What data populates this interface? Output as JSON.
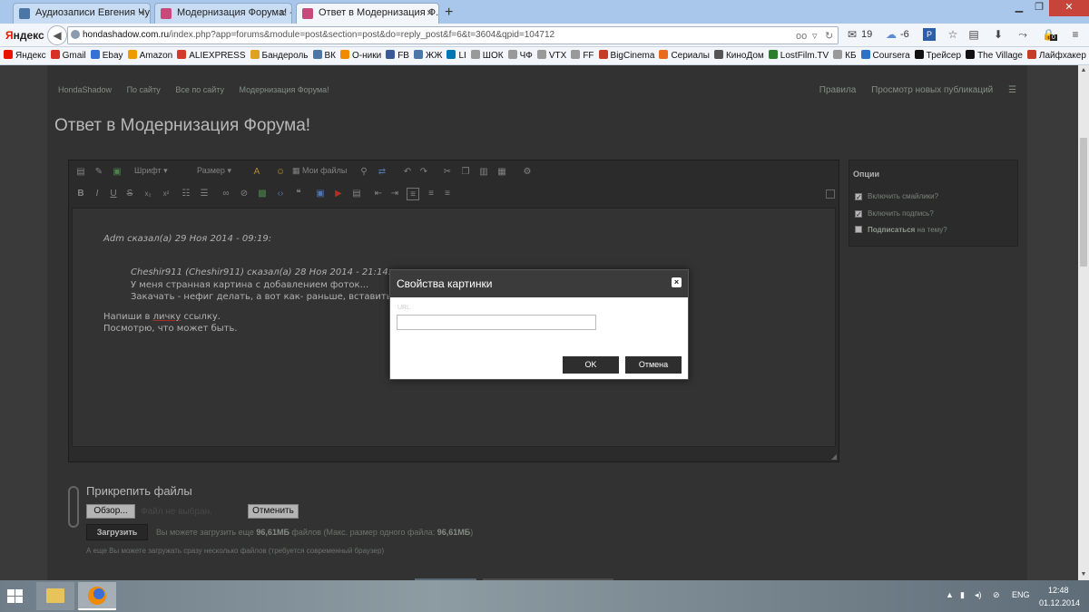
{
  "browser": {
    "tabs": [
      {
        "title": "Аудиозаписи Евгения Чур..."
      },
      {
        "title": "Модернизация Форума! - ..."
      },
      {
        "title": "Ответ в Модернизация Ф..."
      }
    ],
    "new_tab": "+",
    "close_tab": "×",
    "yandex_logo": {
      "y": "Я",
      "rest": "ндекс"
    },
    "url": {
      "host": "hondashadow.com.ru",
      "path": "/index.php?app=forums&module=post&section=post&do=reply_post&f=6&t=3604&qpid=104712"
    },
    "widgets": {
      "mail_count": "19",
      "weather_temp": "-6",
      "badge": "0"
    },
    "bookmarks": [
      {
        "label": "Яндекс",
        "color": "#e61400"
      },
      {
        "label": "Gmail",
        "color": "#d93025"
      },
      {
        "label": "Ebay",
        "color": "#3a6fd8"
      },
      {
        "label": "Amazon",
        "color": "#f09a00"
      },
      {
        "label": "ALIEXPRESS",
        "color": "#d33a2c"
      },
      {
        "label": "Бандероль",
        "color": "#e0a020"
      },
      {
        "label": "ВК",
        "color": "#4a76a8"
      },
      {
        "label": "О-ники",
        "color": "#f08a00"
      },
      {
        "label": "FB",
        "color": "#3b5998"
      },
      {
        "label": "ЖЖ",
        "color": "#4a76a8"
      },
      {
        "label": "LI",
        "color": "#0077b5"
      },
      {
        "label": "ШОК",
        "color": "#999999"
      },
      {
        "label": "ЧФ",
        "color": "#999999"
      },
      {
        "label": "VTX",
        "color": "#999999"
      },
      {
        "label": "FF",
        "color": "#999999"
      },
      {
        "label": "BigCinema",
        "color": "#c83a2a"
      },
      {
        "label": "Сериалы",
        "color": "#e86a1a"
      },
      {
        "label": "КиноДом",
        "color": "#555555"
      },
      {
        "label": "LostFilm.TV",
        "color": "#2a7f2a"
      },
      {
        "label": "КБ",
        "color": "#999999"
      },
      {
        "label": "Coursera",
        "color": "#2a73cc"
      },
      {
        "label": "Трейсер",
        "color": "#111111"
      },
      {
        "label": "The Village",
        "color": "#111111"
      },
      {
        "label": "Лайфхакер",
        "color": "#c83a2a"
      }
    ]
  },
  "forum": {
    "nav_left": [
      "HondaShadow",
      "По сайту",
      "Все по сайту",
      "Модернизация Форума!"
    ],
    "nav_right": [
      "Правила",
      "Просмотр новых публикаций"
    ],
    "page_title": "Ответ в Модернизация Форума!"
  },
  "editor": {
    "font_label": "Шрифт",
    "size_label": "Размер",
    "my_files_label": "Мои файлы",
    "quote1_header": "Adm сказал(а) 29 Ноя 2014 - 09:19:",
    "quote2_header": "Cheshir911 (Cheshir911) сказал(а) 28 Ноя 2014 - 21:14:",
    "quote2_line1": "У меня странная картина с добавлением фоток...",
    "quote2_line2": "Закачать - нефиг делать, а вот как- раньше, вставить сс",
    "reply_line1_pre": "Напиши в ",
    "reply_line1_ul": "личку",
    "reply_line1_post": " ссылку.",
    "reply_line2": "Посмотрю, что может быть."
  },
  "options": {
    "title": "Опции",
    "items": [
      {
        "label": "Включить смайлики?",
        "checked": "✓"
      },
      {
        "label": "Включить подпись?",
        "checked": "✓"
      }
    ],
    "subscribe_bold": "Подписаться",
    "subscribe_rest": " на тему?"
  },
  "attach": {
    "title": "Прикрепить файлы",
    "browse_label": "Обзор...",
    "no_file": "Файл не выбран.",
    "cancel_label": "Отменить",
    "upload_label": "Загрузить",
    "note_pre": "Вы можете загрузить еще ",
    "note_size1": "96,61МБ",
    "note_mid": " файлов (Макс. размер одного файла: ",
    "note_size2": "96,61МБ",
    "note_post": ")",
    "multi_note": "А еще Вы можете загружать сразу несколько файлов (требуется современный браузер)"
  },
  "modal": {
    "title": "Свойства картинки",
    "close": "×",
    "field_label": "URL",
    "url_value": "",
    "ok_label": "OK",
    "cancel_label": "Отмена"
  },
  "taskbar": {
    "lang": "ENG",
    "time": "12:48",
    "date": "01.12.2014"
  }
}
